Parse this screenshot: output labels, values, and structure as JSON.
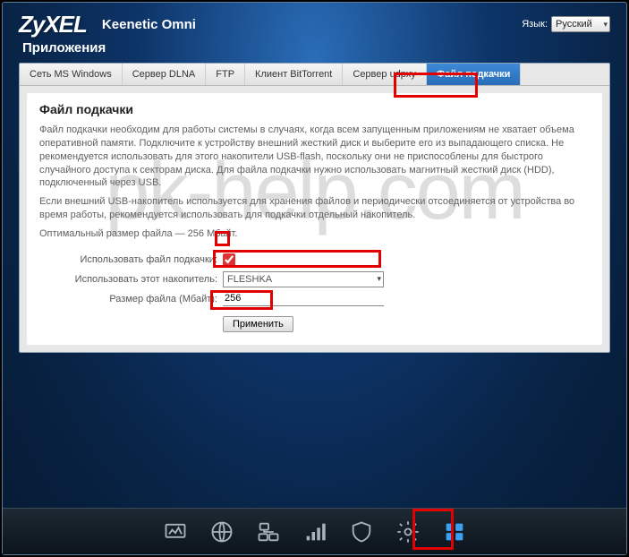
{
  "header": {
    "logo": "ZyXEL",
    "product": "Keenetic Omni",
    "lang_label": "Язык:",
    "lang_value": "Русский"
  },
  "section_title": "Приложения",
  "tabs": [
    {
      "label": "Сеть MS Windows"
    },
    {
      "label": "Сервер DLNA"
    },
    {
      "label": "FTP"
    },
    {
      "label": "Клиент BitTorrent"
    },
    {
      "label": "Сервер udpxy"
    },
    {
      "label": "Файл подкачки",
      "active": true
    }
  ],
  "panel": {
    "title": "Файл подкачки",
    "p1": "Файл подкачки необходим для работы системы в случаях, когда всем запущенным приложениям не хватает объема оперативной памяти. Подключите к устройству внешний жесткий диск и выберите его из выпадающего списка. Не рекомендуется использовать для этого накопители USB-flash, поскольку они не приспособлены для быстрого случайного доступа к секторам диска. Для файла подкачки нужно использовать магнитный жесткий диск (HDD), подключенный через USB.",
    "p2": "Если внешний USB-накопитель используется для хранения файлов и периодически отсоединяется от устройства во время работы, рекомендуется использовать для подкачки отдельный накопитель.",
    "p3": "Оптимальный размер файла — 256 Мбайт.",
    "label_enable": "Использовать файл подкачки:",
    "label_drive": "Использовать этот накопитель:",
    "drive_value": "FLESHKA",
    "label_size": "Размер файла (Мбайт):",
    "size_value": "256",
    "apply": "Применить"
  },
  "watermark": "pk-help.com",
  "bottom_icons": [
    "monitor",
    "globe",
    "network",
    "signal",
    "shield",
    "gear",
    "apps"
  ]
}
